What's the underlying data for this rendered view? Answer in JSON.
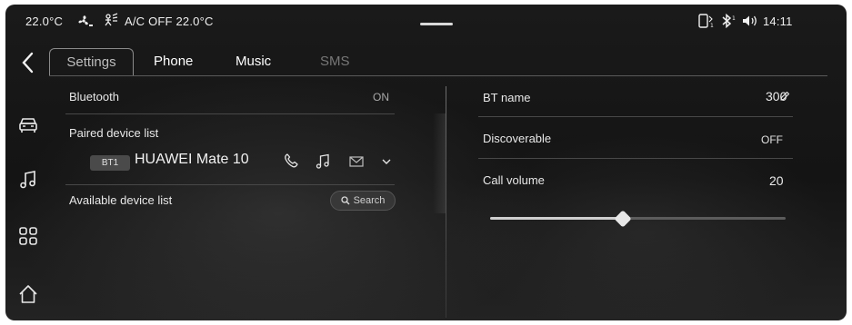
{
  "status_bar": {
    "temp_left": "22.0°C",
    "ac_status": "A/C OFF 22.0°C",
    "clock": "14:11",
    "icons": [
      "fan-icon",
      "ac-airflow-icon",
      "phone-signal-icon",
      "bluetooth-icon",
      "volume-icon"
    ]
  },
  "tabs": [
    {
      "label": "Settings",
      "active": true
    },
    {
      "label": "Phone",
      "active": false
    },
    {
      "label": "Music",
      "active": false
    },
    {
      "label": "SMS",
      "active": false,
      "disabled": true
    }
  ],
  "nav": {
    "icons": [
      "car-icon",
      "music-note-icon",
      "apps-grid-icon",
      "home-icon"
    ]
  },
  "left_panel": {
    "bluetooth": {
      "label": "Bluetooth",
      "value": "ON"
    },
    "paired": {
      "label": "Paired device list",
      "device": {
        "badge": "BT1",
        "name": "HUAWEI Mate 10",
        "icons": [
          "phone-icon",
          "music-note-icon",
          "message-icon",
          "chevron-down-icon"
        ]
      }
    },
    "available": {
      "label": "Available device list",
      "search_label": "Search"
    }
  },
  "right_panel": {
    "bt_name": {
      "label": "BT name",
      "value": "300"
    },
    "discoverable": {
      "label": "Discoverable",
      "value": "OFF"
    },
    "call_volume": {
      "label": "Call volume",
      "value": "20",
      "slider_fraction": 0.45
    }
  },
  "colors": {
    "background": "#161616",
    "text": "#e6e6e6",
    "dim_text": "#777777",
    "divider": "#484848",
    "slider_fill": "#cfcfcf"
  }
}
